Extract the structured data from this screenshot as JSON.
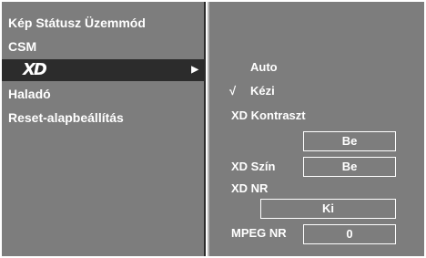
{
  "left_menu": {
    "items": [
      {
        "label": "Kép Státusz Üzemmód"
      },
      {
        "label": "CSM"
      },
      {
        "label": "XD"
      },
      {
        "label": "Haladó"
      },
      {
        "label": "Reset-alapbeállítás"
      }
    ],
    "submenu_arrow": "▶"
  },
  "right_panel": {
    "auto_label": "Auto",
    "check_mark": "√",
    "manual_label": "Kézi",
    "xd_contrast_label": "XD Kontraszt",
    "xd_contrast_value": "Be",
    "xd_color_label": "XD Szín",
    "xd_color_value": "Be",
    "xd_nr_label": "XD NR",
    "xd_nr_value": "Ki",
    "mpeg_nr_label": "MPEG NR",
    "mpeg_nr_value": "0"
  },
  "colors": {
    "panel_bg": "#7d7d7d",
    "selected_bg": "#2c2c2c",
    "text": "#ffffff"
  }
}
